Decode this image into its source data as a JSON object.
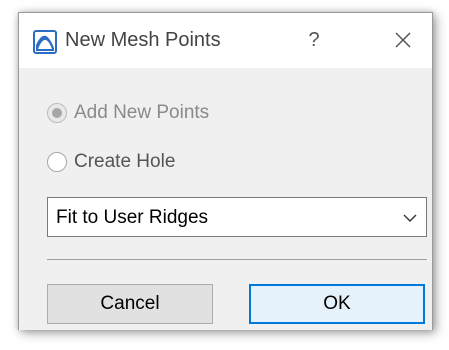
{
  "dialog": {
    "title": "New Mesh Points",
    "help_label": "?",
    "app_icon": "mesh-arc-icon",
    "close_icon": "close-icon"
  },
  "options": {
    "add_new_points": {
      "label": "Add New Points",
      "checked": true,
      "disabled": true
    },
    "create_hole": {
      "label": "Create Hole",
      "checked": false,
      "disabled": false
    }
  },
  "fit_select": {
    "value": "Fit to User Ridges",
    "arrow_icon": "chevron-down-icon"
  },
  "buttons": {
    "cancel_label": "Cancel",
    "ok_label": "OK"
  },
  "colors": {
    "accent": "#0078d7",
    "app_icon_blue": "#2b6cc4"
  }
}
